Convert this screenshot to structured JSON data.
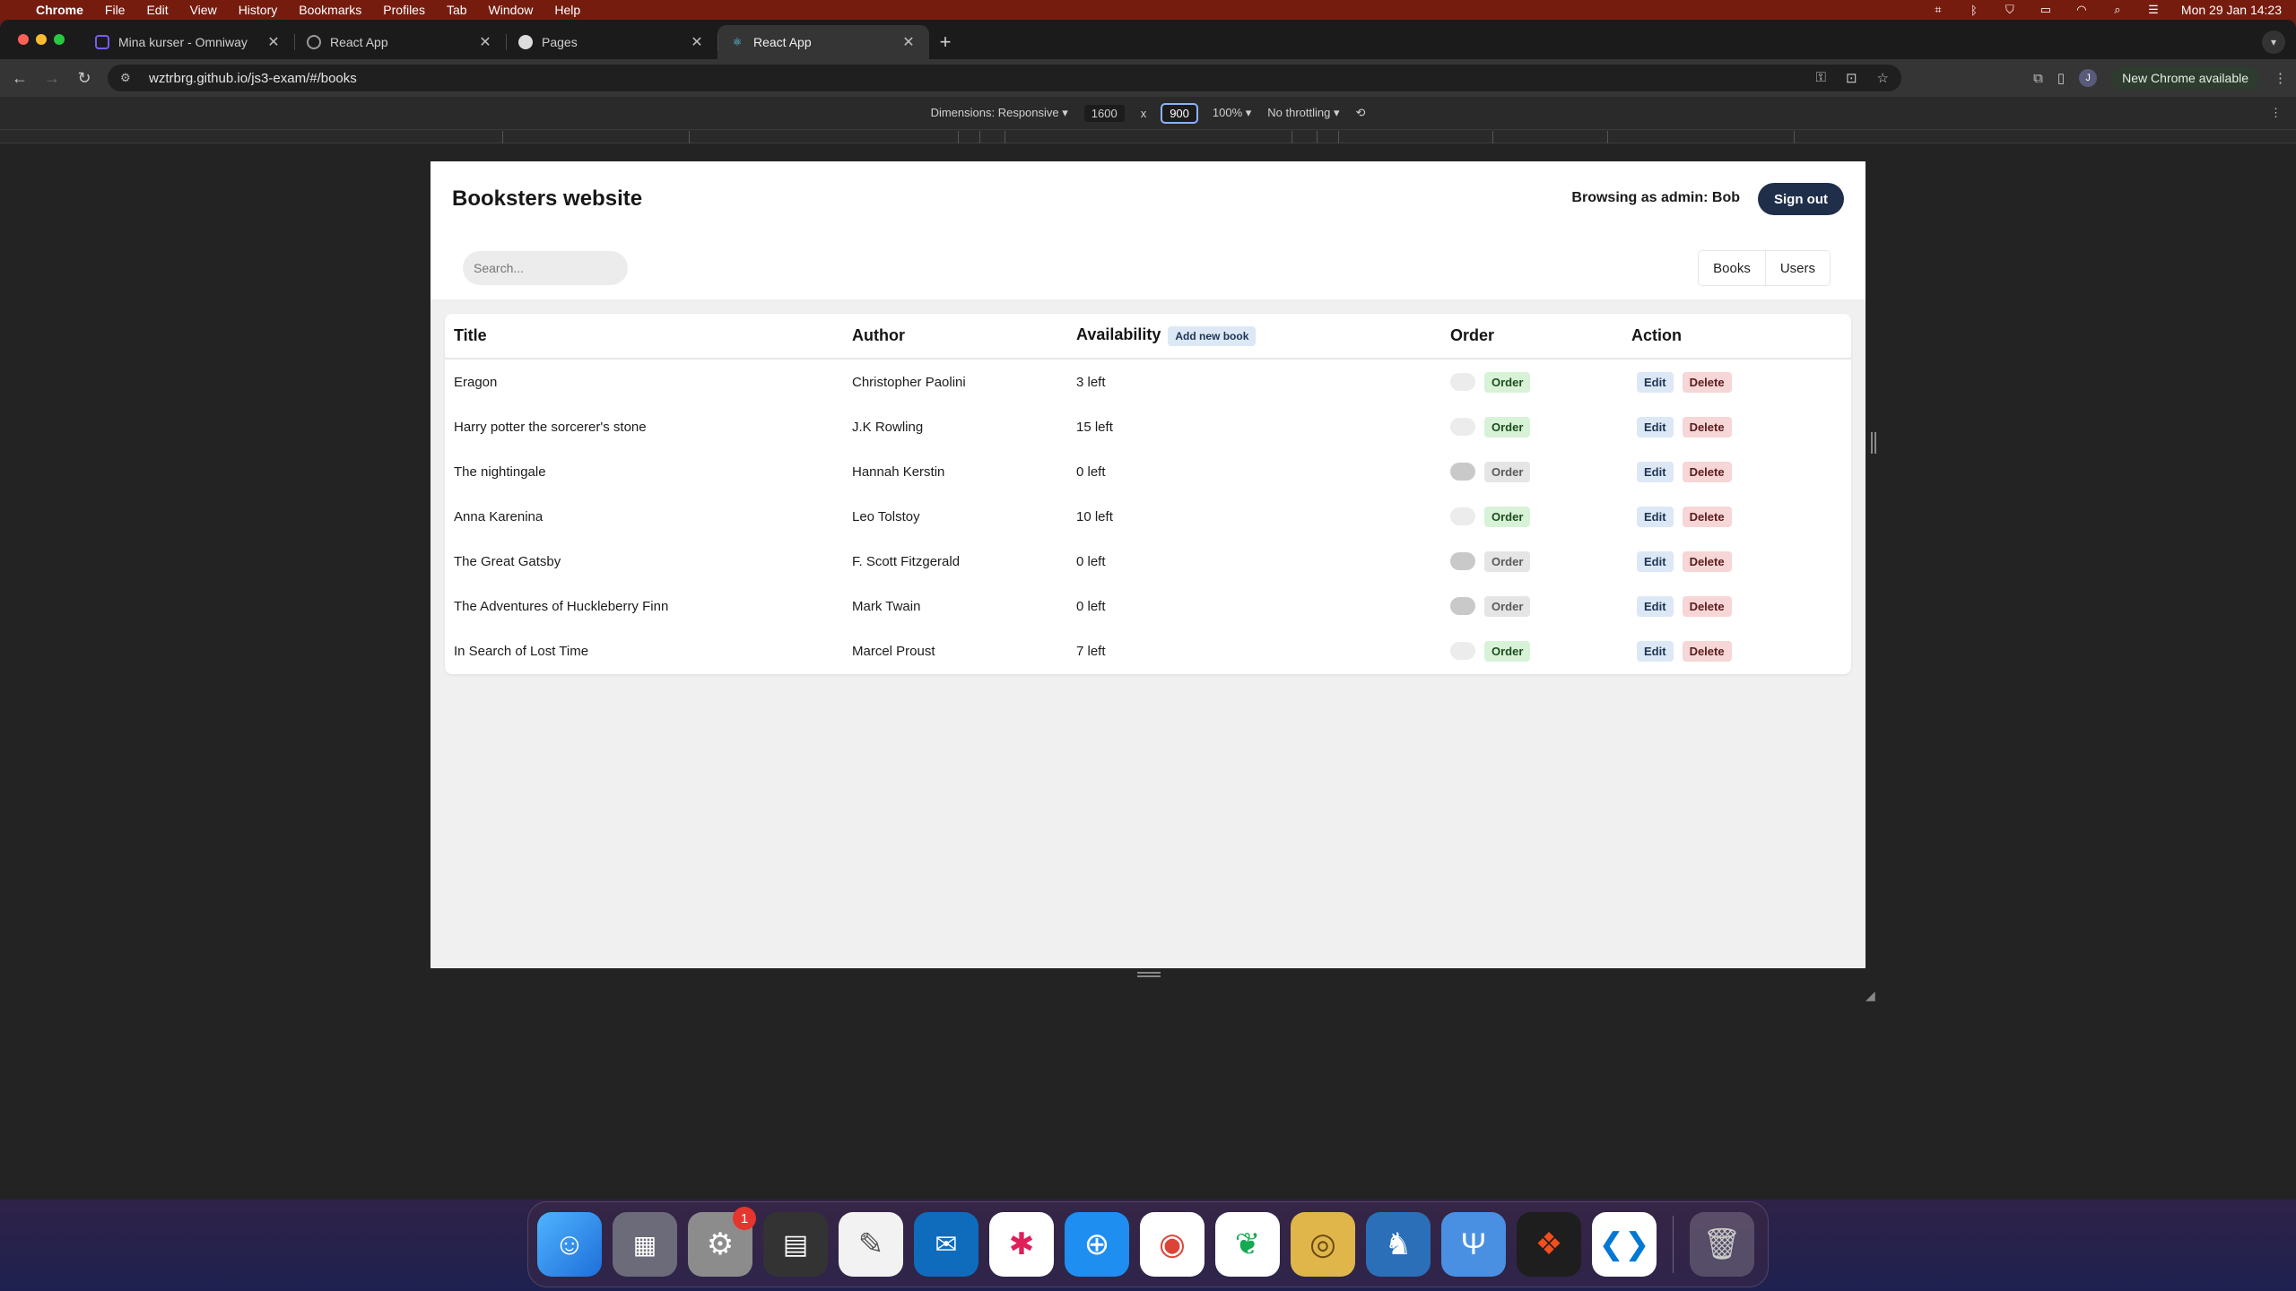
{
  "menubar": {
    "app_name": "Chrome",
    "items": [
      "File",
      "Edit",
      "View",
      "History",
      "Bookmarks",
      "Profiles",
      "Tab",
      "Window",
      "Help"
    ],
    "clock": "Mon 29 Jan  14:23"
  },
  "tabs": [
    {
      "title": "Mina kurser - Omniway",
      "active": false
    },
    {
      "title": "React App",
      "active": false
    },
    {
      "title": "Pages",
      "active": false
    },
    {
      "title": "React App",
      "active": true
    }
  ],
  "toolbar": {
    "url": "wztrbrg.github.io/js3-exam/#/books",
    "new_chrome": "New Chrome available",
    "profile_initial": "J"
  },
  "devtools": {
    "dimensions_label": "Dimensions: Responsive ▾",
    "width": "1600",
    "times": "x",
    "height": "900",
    "zoom": "100% ▾",
    "throttling": "No throttling ▾"
  },
  "page": {
    "site_title": "Booksters website",
    "browsing_as": "Browsing as admin: Bob",
    "sign_out": "Sign out",
    "search_placeholder": "Search...",
    "nav": {
      "books": "Books",
      "users": "Users"
    },
    "table": {
      "headers": {
        "title": "Title",
        "author": "Author",
        "availability": "Availability",
        "order": "Order",
        "action": "Action"
      },
      "add_new_book": "Add new book",
      "order_label": "Order",
      "edit_label": "Edit",
      "delete_label": "Delete",
      "rows": [
        {
          "title": "Eragon",
          "author": "Christopher Paolini",
          "availability": "3 left",
          "orderable": true
        },
        {
          "title": "Harry potter the sorcerer's stone",
          "author": "J.K Rowling",
          "availability": "15 left",
          "orderable": true
        },
        {
          "title": "The nightingale",
          "author": "Hannah Kerstin",
          "availability": "0 left",
          "orderable": false
        },
        {
          "title": "Anna Karenina",
          "author": "Leo Tolstoy",
          "availability": "10 left",
          "orderable": true
        },
        {
          "title": "The Great Gatsby",
          "author": "F. Scott Fitzgerald",
          "availability": "0 left",
          "orderable": false
        },
        {
          "title": "The Adventures of Huckleberry Finn",
          "author": "Mark Twain",
          "availability": "0 left",
          "orderable": false
        },
        {
          "title": "In Search of Lost Time",
          "author": "Marcel Proust",
          "availability": "7 left",
          "orderable": true
        }
      ]
    }
  },
  "dock": {
    "apps": [
      "finder-icon",
      "launchpad-icon",
      "system-settings-icon",
      "calculator-icon",
      "textedit-icon",
      "outlook-icon",
      "slack-icon",
      "safari-icon",
      "chrome-icon",
      "mongodb-icon",
      "sequel-icon",
      "tableplus-icon",
      "fork-icon",
      "figma-icon",
      "vscode-icon",
      "trash-icon"
    ],
    "settings_badge": "1"
  },
  "colors": {
    "accent_dark": "#1f2f4a",
    "order_green": "#d8f2d8",
    "delete_red": "#f6d6d6",
    "edit_blue": "#dce8f6"
  }
}
